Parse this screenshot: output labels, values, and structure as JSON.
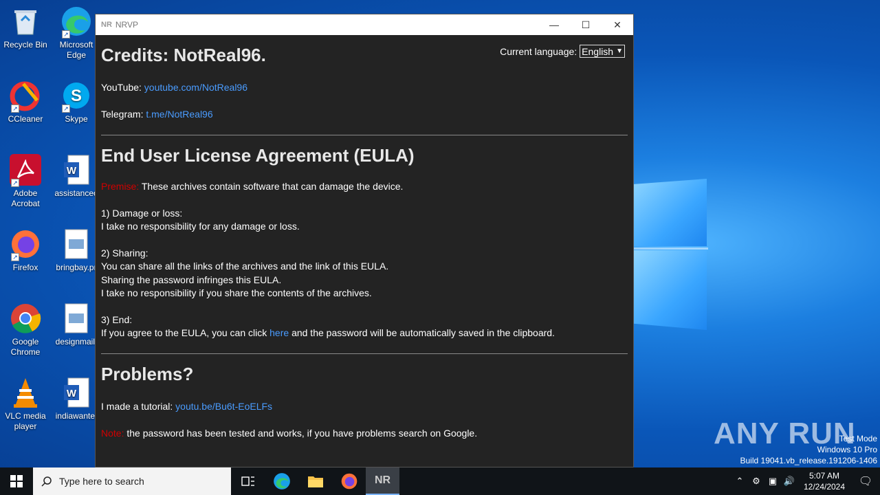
{
  "desktop": {
    "icons": [
      {
        "label": "Recycle Bin"
      },
      {
        "label": "Microsoft Edge"
      },
      {
        "label": "CCleaner"
      },
      {
        "label": "Skype"
      },
      {
        "label": "Adobe Acrobat"
      },
      {
        "label": "assistanceo"
      },
      {
        "label": "Firefox"
      },
      {
        "label": "bringbay.pr"
      },
      {
        "label": "Google Chrome"
      },
      {
        "label": "designmail."
      },
      {
        "label": "VLC media player"
      },
      {
        "label": "indiawante."
      }
    ],
    "watermark": "ANY RUN",
    "test_mode": {
      "line1": "Test Mode",
      "line2": "Windows 10 Pro",
      "line3": "Build 19041.vb_release.191206-1406"
    }
  },
  "window": {
    "title_logo": "NR",
    "title": "NRVP",
    "language_label": "Current language:",
    "language_value": "English",
    "credits_heading": "Credits: NotReal96.",
    "youtube_label": "YouTube:",
    "youtube_link": "youtube.com/NotReal96",
    "telegram_label": "Telegram:",
    "telegram_link": "t.me/NotReal96",
    "eula_heading": "End User License Agreement (EULA)",
    "premise_label": "Premise:",
    "premise_text": "These archives contain software that can damage the device.",
    "s1_title": "1) Damage or loss:",
    "s1_line1": "I take no responsibility for any damage or loss.",
    "s2_title": "2) Sharing:",
    "s2_line1": "You can share all the links of the archives and the link of this EULA.",
    "s2_line2": "Sharing the password infringes this EULA.",
    "s2_line3": "I take no responsibility if you share the contents of the archives.",
    "s3_title": "3) End:",
    "s3_pre": "If you agree to the EULA, you can click",
    "s3_link": "here",
    "s3_post": "and the password will be automatically saved in the clipboard.",
    "problems_heading": "Problems?",
    "tutorial_label": "I made a tutorial:",
    "tutorial_link": "youtu.be/Bu6t-EoELFs",
    "note_label": "Note:",
    "note_text": "the password has been tested and works, if you have problems search on Google."
  },
  "taskbar": {
    "search_placeholder": "Type here to search",
    "active_app_label": "NR",
    "time": "5:07 AM",
    "date": "12/24/2024"
  }
}
